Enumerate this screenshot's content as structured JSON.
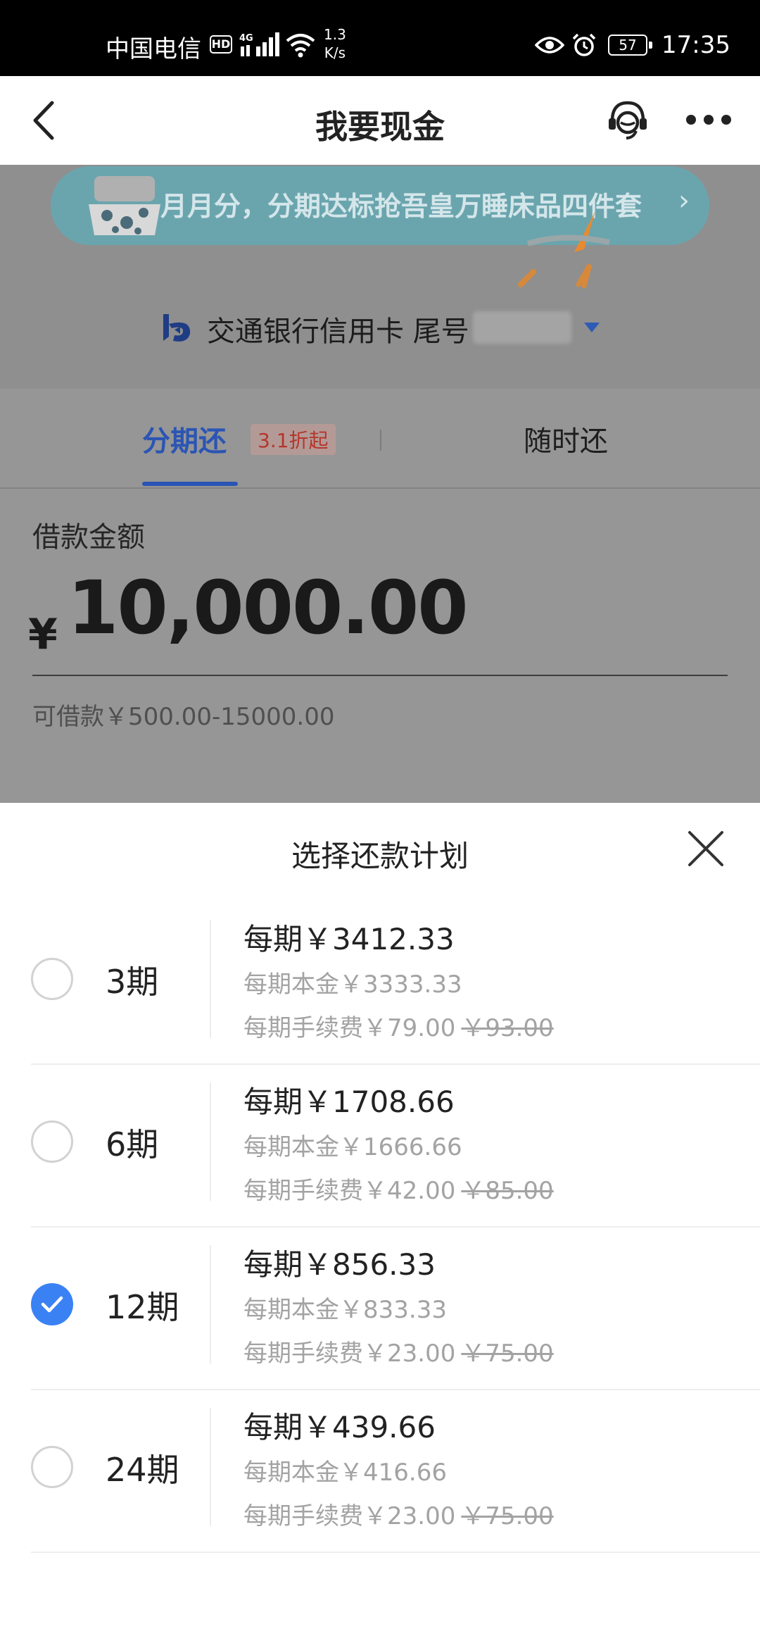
{
  "status_bar": {
    "carrier": "中国电信",
    "hd": "HD",
    "network": "4G",
    "speed_value": "1.3",
    "speed_unit": "K/s",
    "battery": "57",
    "time": "17:35"
  },
  "nav": {
    "title": "我要现金",
    "back_icon": "chevron-left-icon",
    "service_icon": "customer-service-icon",
    "more_icon": "more-dots-icon"
  },
  "promo": {
    "text": "月月分，分期达标抢吾皇万睡床品四件套",
    "arrow": "›"
  },
  "card": {
    "bank_name": "交通银行信用卡 尾号"
  },
  "tabs": [
    {
      "label": "分期还",
      "badge": "3.1折起",
      "active": true
    },
    {
      "label": "随时还",
      "active": false
    }
  ],
  "loan": {
    "amount_label": "借款金额",
    "currency": "¥",
    "amount": "10,000.00",
    "range_text": "可借款￥500.00-15000.00"
  },
  "sheet": {
    "title": "选择还款计划",
    "plans": [
      {
        "term": "3期",
        "per_period": "每期￥3412.33",
        "principal": "每期本金￥3333.33",
        "fee": "每期手续费￥79.00",
        "fee_original": "￥93.00",
        "selected": false
      },
      {
        "term": "6期",
        "per_period": "每期￥1708.66",
        "principal": "每期本金￥1666.66",
        "fee": "每期手续费￥42.00",
        "fee_original": "￥85.00",
        "selected": false
      },
      {
        "term": "12期",
        "per_period": "每期￥856.33",
        "principal": "每期本金￥833.33",
        "fee": "每期手续费￥23.00",
        "fee_original": "￥75.00",
        "selected": true
      },
      {
        "term": "24期",
        "per_period": "每期￥439.66",
        "principal": "每期本金￥416.66",
        "fee": "每期手续费￥23.00",
        "fee_original": "￥75.00",
        "selected": false
      }
    ]
  },
  "colors": {
    "accent": "#3a82f4",
    "tab_active": "#2b55b4",
    "badge_text": "#b5362c",
    "muted_text": "#a3a3a3"
  }
}
